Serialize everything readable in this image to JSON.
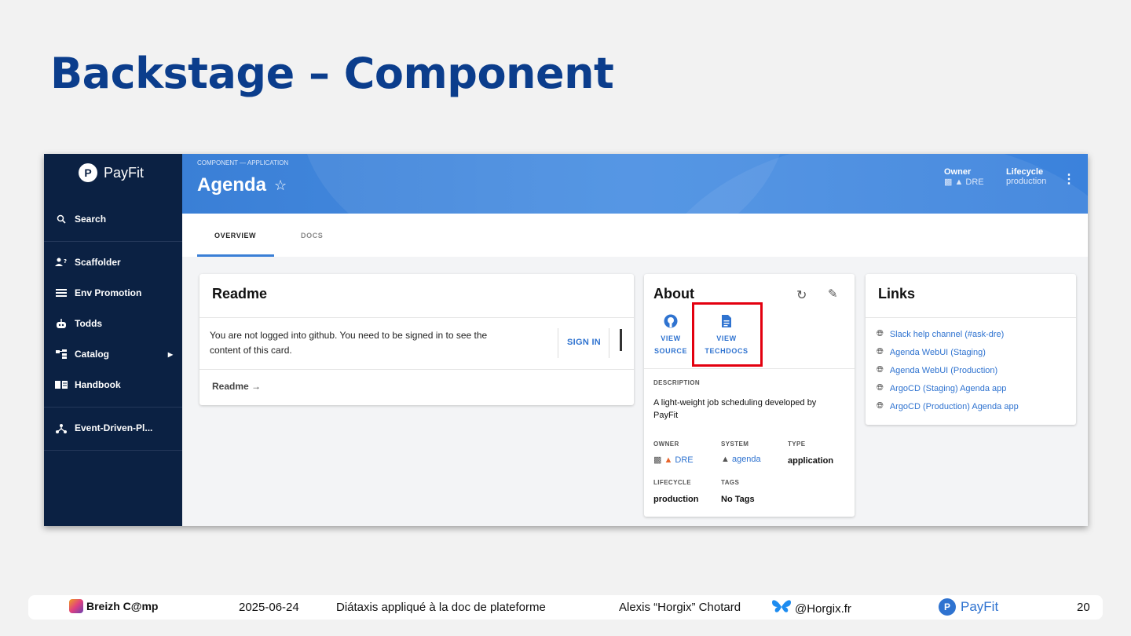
{
  "slide": {
    "title": "Backstage – Component"
  },
  "sidebar": {
    "brand": "PayFit",
    "items": [
      {
        "label": "Search",
        "icon": "search-icon"
      },
      {
        "label": "Scaffolder",
        "icon": "users-plus-icon"
      },
      {
        "label": "Env Promotion",
        "icon": "list-icon"
      },
      {
        "label": "Todds",
        "icon": "robot-icon"
      },
      {
        "label": "Catalog",
        "icon": "catalog-icon"
      },
      {
        "label": "Handbook",
        "icon": "book-icon"
      },
      {
        "label": "Event-Driven-Pl...",
        "icon": "hub-icon"
      }
    ]
  },
  "header": {
    "breadcrumb": "COMPONENT — APPLICATION",
    "title": "Agenda",
    "owner_label": "Owner",
    "owner_value": "DRE",
    "lifecycle_label": "Lifecycle",
    "lifecycle_value": "production"
  },
  "tabs": [
    {
      "label": "OVERVIEW"
    },
    {
      "label": "DOCS"
    }
  ],
  "readme": {
    "title": "Readme",
    "message": "You are not logged into github. You need to be signed in to see the content of this card.",
    "sign_in": "SIGN IN",
    "link": "Readme"
  },
  "about": {
    "title": "About",
    "view_source": "VIEW SOURCE",
    "view_techdocs": "VIEW TECHDOCS",
    "description_label": "DESCRIPTION",
    "description": "A light-weight job scheduling developed by PayFit",
    "owner_label": "OWNER",
    "owner": "DRE",
    "system_label": "SYSTEM",
    "system": "agenda",
    "type_label": "TYPE",
    "type": "application",
    "lifecycle_label": "LIFECYCLE",
    "lifecycle": "production",
    "tags_label": "TAGS",
    "tags": "No Tags"
  },
  "links": {
    "title": "Links",
    "items": [
      "Slack help channel (#ask-dre)",
      "Agenda WebUI (Staging)",
      "Agenda WebUI (Production)",
      "ArgoCD (Staging) Agenda app",
      "ArgoCD (Production) Agenda app"
    ]
  },
  "footer": {
    "event": "Breizh C@mp",
    "date": "2025-06-24",
    "talk": "Diátaxis appliqué à la doc de plateforme",
    "speaker": "Alexis “Horgix” Chotard",
    "handle": "@Horgix.fr",
    "company": "PayFit",
    "page": "20"
  },
  "colors": {
    "title": "#0b3d8c",
    "sidebar": "#0b2143",
    "accent": "#2f73d0",
    "highlight": "#e3000f"
  }
}
